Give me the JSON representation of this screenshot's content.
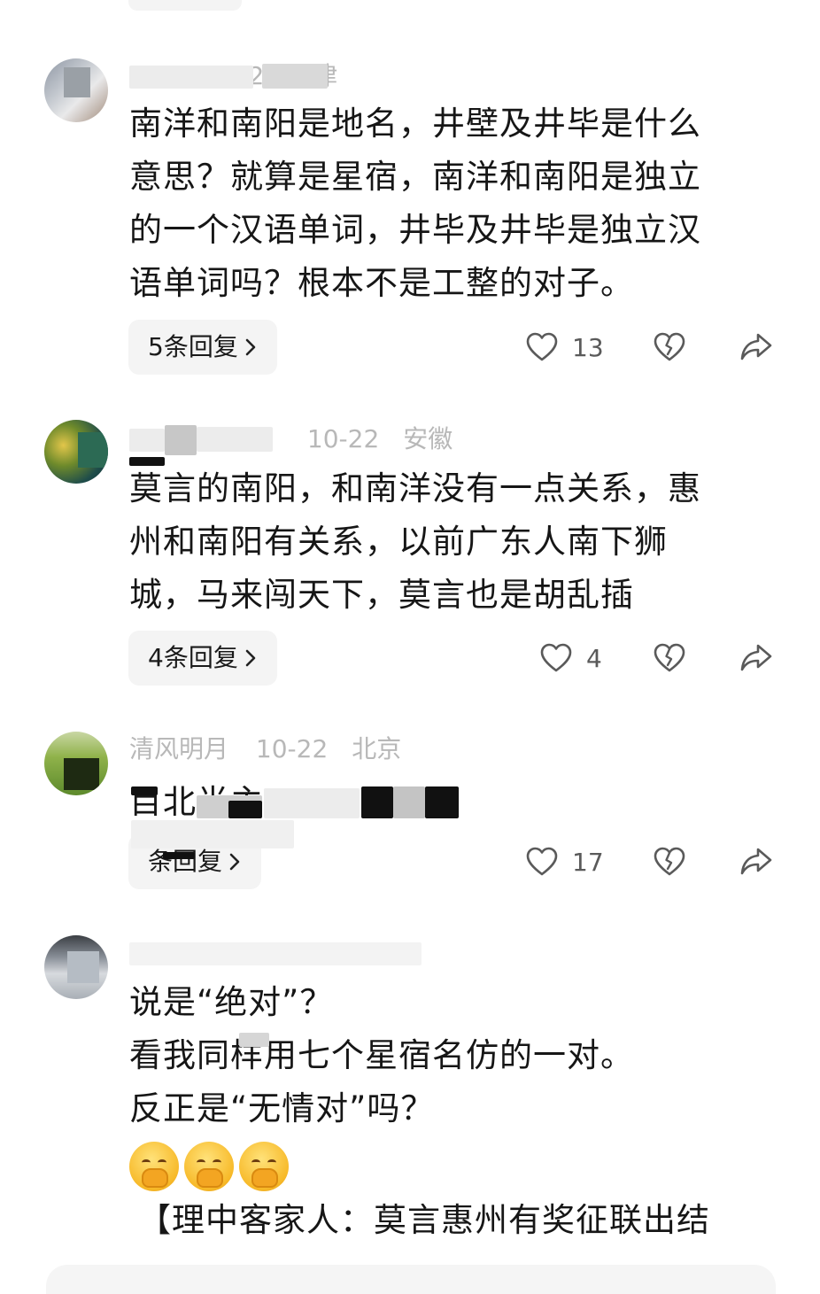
{
  "comments": [
    {
      "user_name": "",
      "date": "10-22",
      "location": "天津",
      "lines": [
        "南洋和南阳是地名，井壁及井毕是什么",
        "意思？就算是星宿，南洋和南阳是独立",
        "的一个汉语单词，井毕及井毕是独立汉",
        "语单词吗？根本不是工整的对子。"
      ],
      "reply_label": "5条回复",
      "likes": "13"
    },
    {
      "user_name": "",
      "date": "10-22",
      "location": "安徽",
      "lines": [
        "莫言的南阳，和南洋没有一点关系，惠",
        "州和南阳有关系，以前广东人南下狮",
        "城，马来闯天下，莫言也是胡乱插"
      ],
      "reply_label": "4条回复",
      "likes": "4"
    },
    {
      "user_name": "清风明月",
      "date": "10-22",
      "location": "北京",
      "lines": [
        "目北半主"
      ],
      "reply_label": "条回复",
      "likes": "17"
    },
    {
      "user_name": "",
      "date": "",
      "location": "",
      "lines": [
        "说是“绝对”？",
        "看我同样用七个星宿名仿的一对。",
        "反正是“无情对”吗？"
      ],
      "quote_line": "【理中客家人：莫言惠州有奖征联出结"
    }
  ],
  "icons": {
    "like": "heart-outline-icon",
    "dislike": "broken-heart-icon",
    "share": "share-arrow-icon",
    "chevron": "chevron-right-icon",
    "emoji": "face-with-hand-over-mouth-emoji"
  },
  "colors": {
    "meta_text": "#b8b8b8",
    "body_text": "#161616",
    "pill_bg": "#f4f4f4",
    "icon": "#5a5a5a"
  }
}
